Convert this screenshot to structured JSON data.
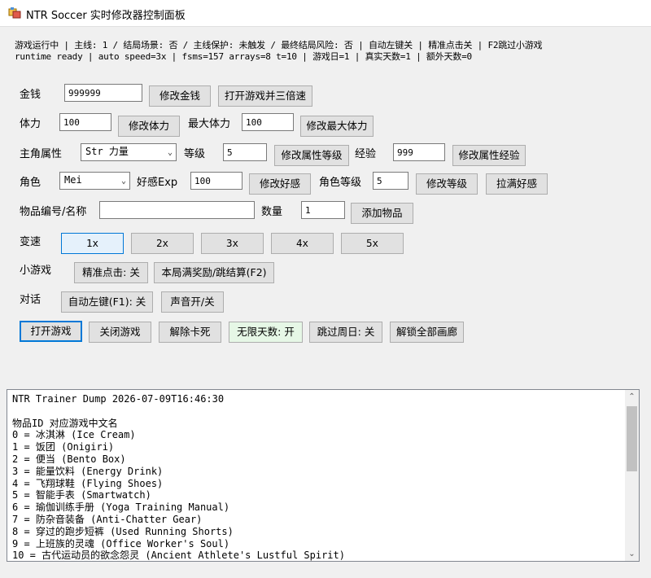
{
  "window": {
    "title": "NTR Soccer 实时修改器控制面板",
    "icon": "app-window-icon"
  },
  "status": {
    "line1": "游戏运行中 | 主线: 1 / 结局场景: 否 / 主线保护: 未触发 / 最终结局风险: 否 | 自动左键关 | 精准点击关 | F2跳过小游戏",
    "line2": "runtime ready | auto speed=3x | fsms=157 arrays=8 t=10 | 游戏日=1 | 真实天数=1 | 额外天数=0"
  },
  "money": {
    "label": "金钱",
    "value": "999999",
    "set_button": "修改金钱",
    "open_button": "打开游戏并三倍速"
  },
  "stamina": {
    "label": "体力",
    "value": "100",
    "set_button": "修改体力",
    "max_label": "最大体力",
    "max_value": "100",
    "max_button": "修改最大体力"
  },
  "attribute": {
    "label": "主角属性",
    "selected": "Str 力量",
    "level_label": "等级",
    "level_value": "5",
    "level_button": "修改属性等级",
    "exp_label": "经验",
    "exp_value": "999",
    "exp_button": "修改属性经验"
  },
  "character": {
    "label": "角色",
    "selected": "Mei",
    "affection_label": "好感Exp",
    "affection_value": "100",
    "affection_button": "修改好感",
    "level_label": "角色等级",
    "level_value": "5",
    "level_button": "修改等级",
    "max_button": "拉满好感"
  },
  "item": {
    "label": "物品编号/名称",
    "value": "",
    "qty_label": "数量",
    "qty_value": "1",
    "add_button": "添加物品"
  },
  "speed": {
    "label": "变速",
    "options": [
      "1x",
      "2x",
      "3x",
      "4x",
      "5x"
    ]
  },
  "minigame": {
    "label": "小游戏",
    "precise_button": "精准点击: 关",
    "reward_button": "本局满奖励/跳结算(F2)"
  },
  "dialog": {
    "label": "对话",
    "auto_button": "自动左键(F1): 关",
    "sound_button": "声音开/关"
  },
  "actions": {
    "open": "打开游戏",
    "close": "关闭游戏",
    "unstuck": "解除卡死",
    "infinite": "无限天数: 开",
    "skip_weekend": "跳过周日: 关",
    "unlock": "解锁全部画廊"
  },
  "log": {
    "lines": [
      "NTR Trainer Dump 2026-07-09T16:46:30",
      "",
      "物品ID 对应游戏中文名",
      "0 = 冰淇淋 (Ice Cream)",
      "1 = 饭团 (Onigiri)",
      "2 = 便当 (Bento Box)",
      "3 = 能量饮料 (Energy Drink)",
      "4 = 飞翔球鞋 (Flying Shoes)",
      "5 = 智能手表 (Smartwatch)",
      "6 = 瑜伽训练手册 (Yoga Training Manual)",
      "7 = 防杂音装备 (Anti-Chatter Gear)",
      "8 = 穿过的跑步短裤 (Used Running Shorts)",
      "9 = 上班族的灵魂 (Office Worker's Soul)",
      "10 = 古代运动员的欲念怨灵 (Ancient Athlete's Lustful Spirit)"
    ]
  }
}
